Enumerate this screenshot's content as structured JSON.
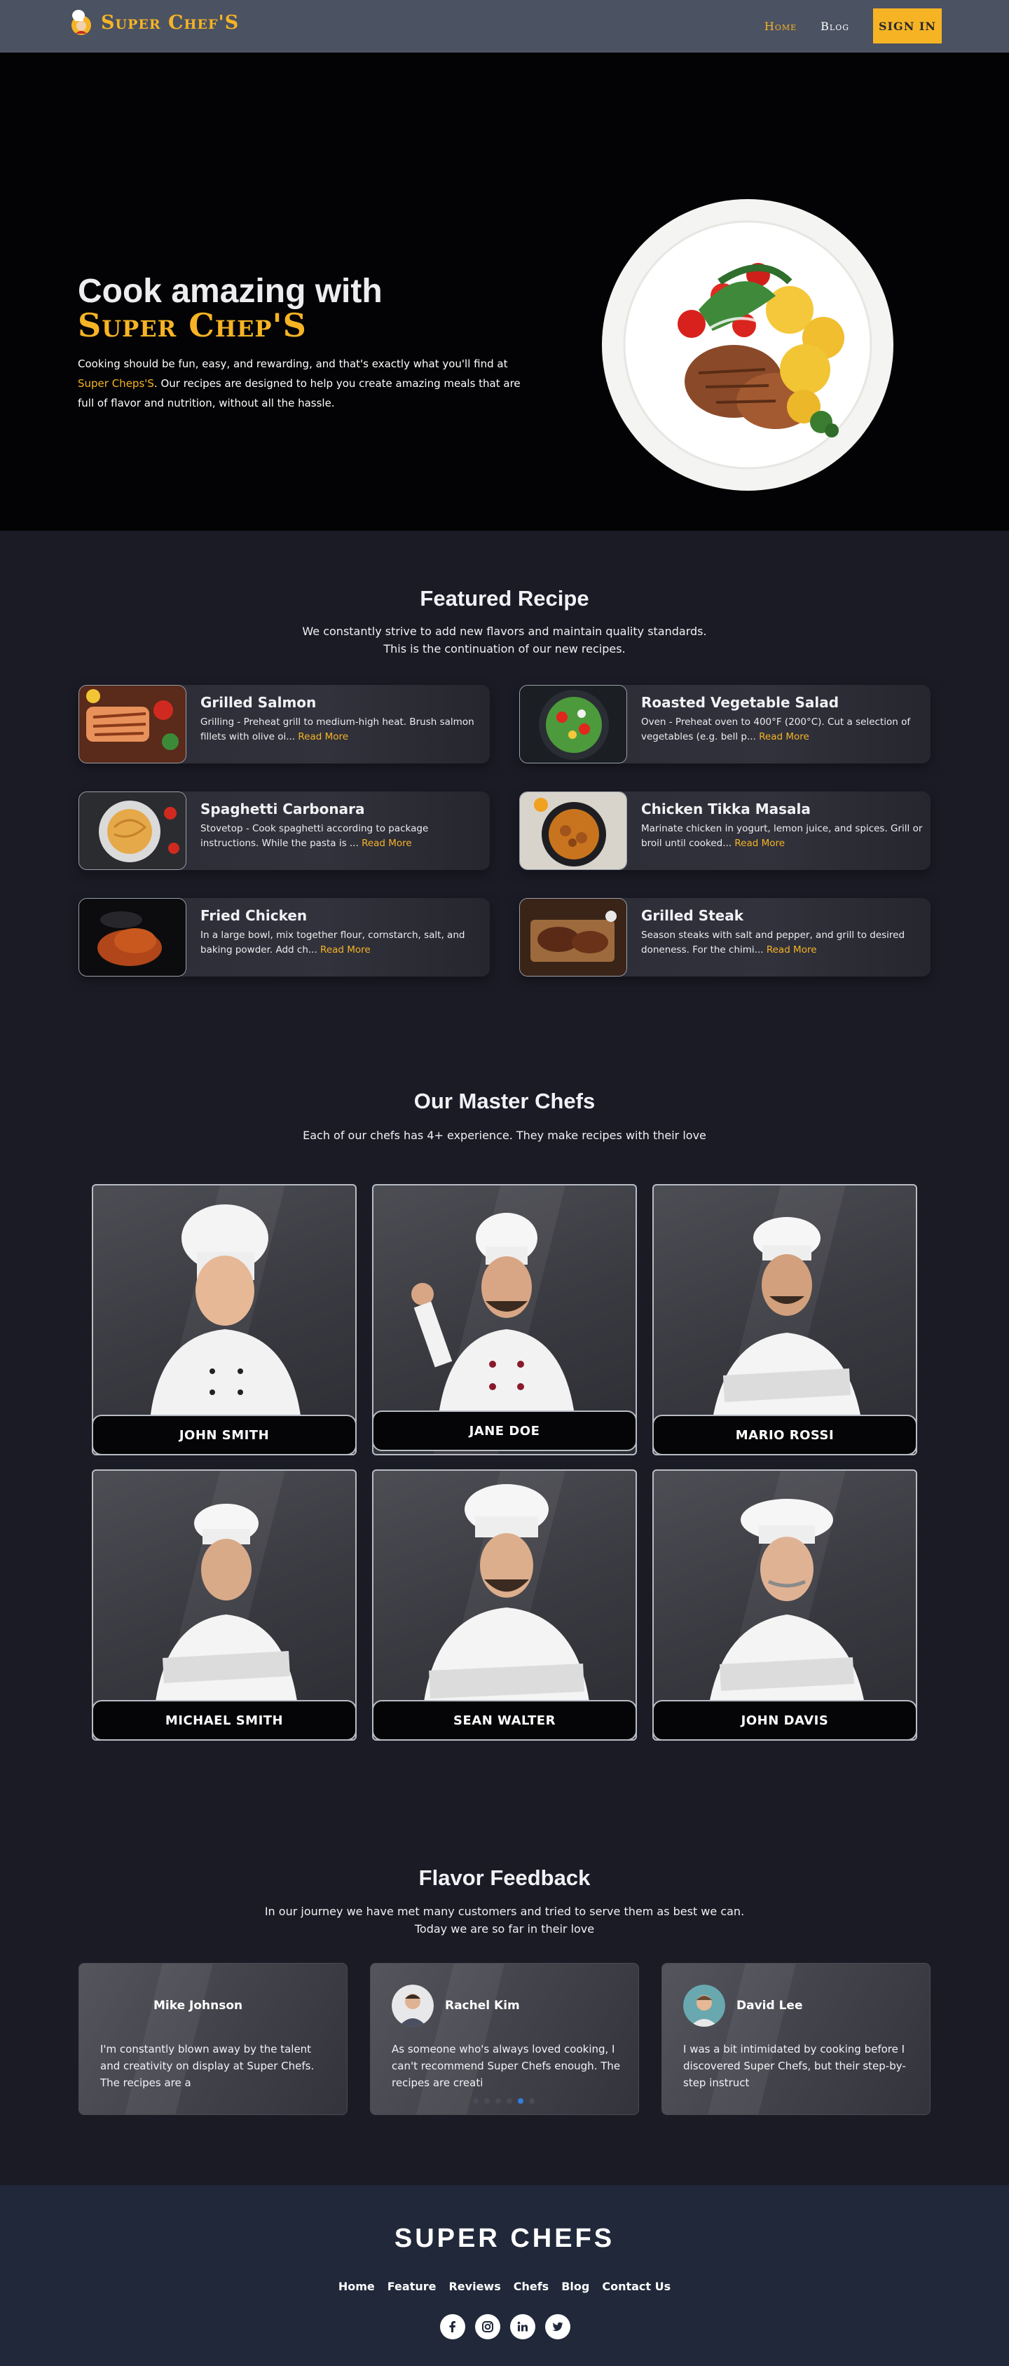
{
  "nav": {
    "brand": "Super Chef'S",
    "links": [
      "Home",
      "Blog"
    ],
    "signin": "SIGN IN"
  },
  "hero": {
    "title": "Cook amazing with",
    "brand": "Super Chep'S",
    "text_before": "Cooking should be fun, easy, and rewarding, and that's exactly what you'll find at ",
    "text_highlight": "Super Cheps'S",
    "text_after": ". Our recipes are designed to help you create amazing meals that are full of flavor and nutrition, without all the hassle."
  },
  "featured": {
    "title": "Featured Recipe",
    "subtitle": "We constantly strive to add new flavors and maintain quality standards. This is the continuation of our new recipes.",
    "read_more": "Read More",
    "recipes": [
      {
        "name": "Grilled Salmon",
        "desc": "Grilling - Preheat grill to medium-high heat. Brush salmon fillets with olive oi... "
      },
      {
        "name": "Roasted Vegetable Salad",
        "desc": "Oven - Preheat oven to 400°F (200°C). Cut a selection of vegetables (e.g. bell p... "
      },
      {
        "name": "Spaghetti Carbonara",
        "desc": "Stovetop - Cook spaghetti according to package instructions. While the pasta is ... "
      },
      {
        "name": "Chicken Tikka Masala",
        "desc": "Marinate chicken in yogurt, lemon juice, and spices. Grill or broil until cooked... "
      },
      {
        "name": "Fried Chicken",
        "desc": "In a large bowl, mix together flour, cornstarch, salt, and baking powder. Add ch... "
      },
      {
        "name": "Grilled Steak",
        "desc": "Season steaks with salt and pepper, and grill to desired doneness. For the chimi... "
      }
    ]
  },
  "chefs": {
    "title": "Our Master Chefs",
    "subtitle": "Each of our chefs has 4+ experience. They make recipes with their love",
    "list": [
      "JOHN SMITH",
      "JANE DOE",
      "MARIO ROSSI",
      "MICHAEL SMITH",
      "SEAN WALTER",
      "JOHN DAVIS"
    ]
  },
  "feedback": {
    "title": "Flavor Feedback",
    "subtitle_1": "In our journey we have met many customers and tried to serve them as best we can.",
    "subtitle_2": "Today we are so far in their love",
    "reviews": [
      {
        "name": "Mike Johnson",
        "text": "I'm constantly blown away by the talent and creativity on display at Super Chefs. The recipes are a"
      },
      {
        "name": "Rachel Kim",
        "text": "As someone who's always loved cooking, I can't recommend Super Chefs enough. The recipes are creati"
      },
      {
        "name": "David Lee",
        "text": "I was a bit intimidated by cooking before I discovered Super Chefs, but their step-by-step instruct"
      }
    ],
    "active_slide": 4,
    "slide_count": 6
  },
  "footer": {
    "brand": "SUPER CHEFS",
    "links": [
      "Home",
      "Feature",
      "Reviews",
      "Chefs",
      "Blog",
      "Contact Us"
    ],
    "socials": [
      "facebook-icon",
      "instagram-icon",
      "linkedin-icon",
      "twitter-icon"
    ]
  },
  "colors": {
    "accent": "#f6b425",
    "nav_bg": "#4b5262",
    "page_bg": "#1b1b26",
    "footer_bg": "#20283a",
    "dot_active": "#2f7fe0"
  }
}
